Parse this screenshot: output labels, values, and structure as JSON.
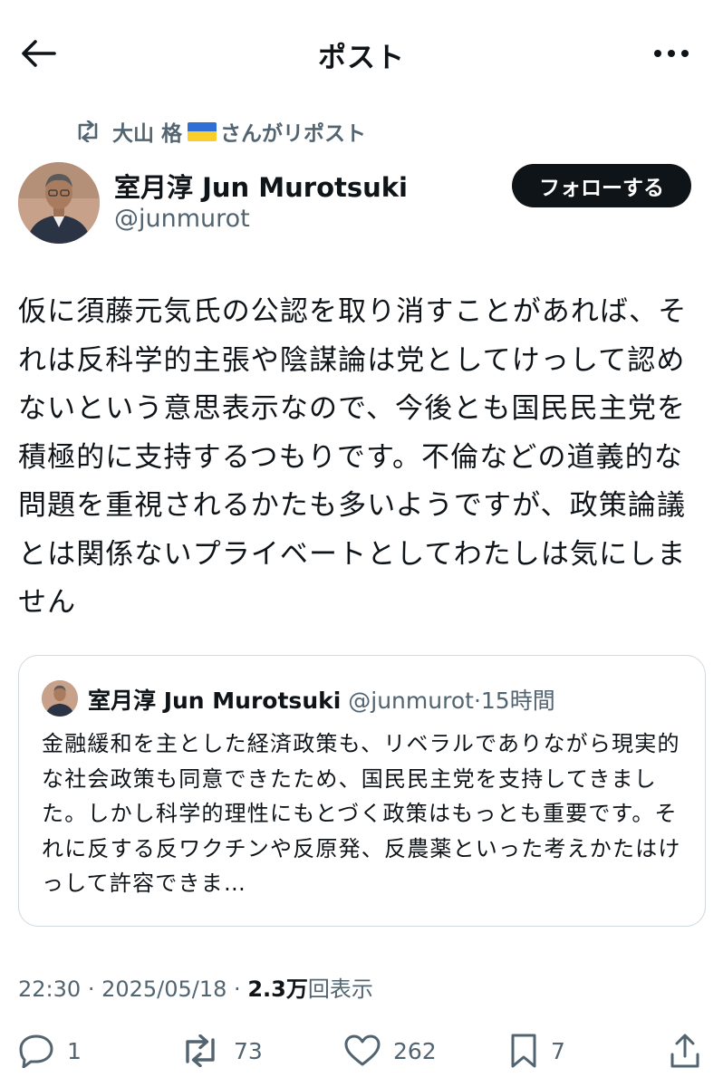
{
  "header": {
    "title": "ポスト",
    "back_icon": "arrow-left-icon",
    "more_icon": "more-horizontal-icon"
  },
  "repost": {
    "reposter_name": "大山 格",
    "suffix": "さんがリポスト"
  },
  "post": {
    "author_name": "室月淳 Jun Murotsuki",
    "author_handle": "@junmurot",
    "follow_label": "フォローする",
    "text": "仮に須藤元気氏の公認を取り消すことがあれば、それは反科学的主張や陰謀論は党としてけっして認めないという意思表示なので、今後とも国民民主党を積極的に支持するつもりです。不倫などの道義的な問題を重視されるかたも多いようですが、政策論議とは関係ないプライベートとしてわたしは気にしません",
    "time": "22:30",
    "date": "2025/05/18",
    "views_count": "2.3万",
    "views_label": "回表示"
  },
  "quote": {
    "author_name": "室月淳 Jun Murotsuki",
    "author_handle": "@junmurot",
    "time_ago": "15時間",
    "text": "金融緩和を主とした経済政策も、リベラルでありながら現実的な社会政策も同意できたため、国民民主党を支持してきました。しかし科学的理性にもとづく政策はもっとも重要です。それに反する反ワクチンや反原発、反農薬といった考えかたはけっして許容できま…"
  },
  "actions": {
    "replies": "1",
    "reposts": "73",
    "likes": "262",
    "bookmarks": "7"
  },
  "colors": {
    "text": "#0f1419",
    "secondary": "#536471",
    "border": "#cfd9de",
    "follow_bg": "#0f1419"
  }
}
